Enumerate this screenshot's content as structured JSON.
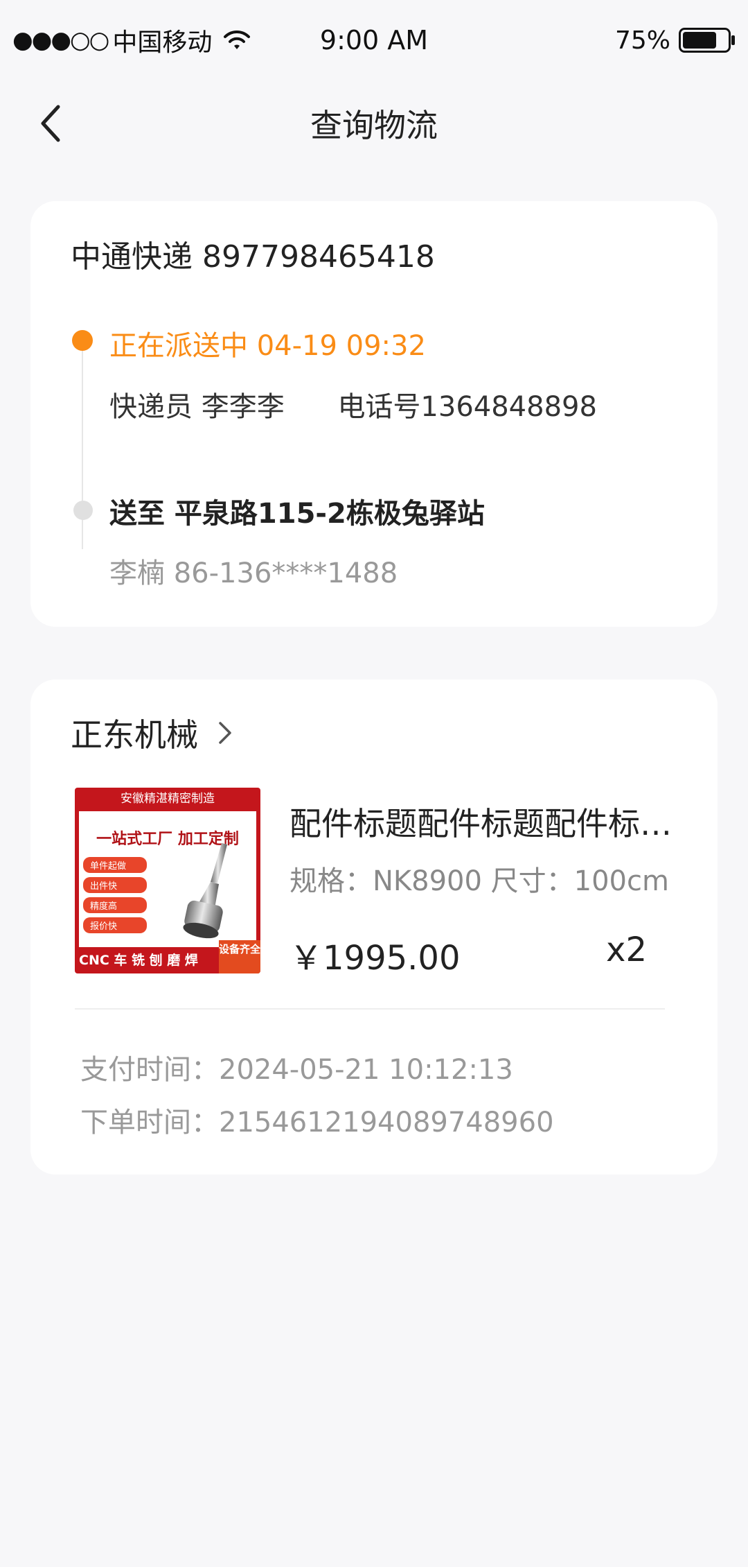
{
  "status_bar": {
    "signal": "●●●○○",
    "carrier": "中国移动",
    "time": "9:00 AM",
    "battery_pct": "75%",
    "battery_level": 0.75
  },
  "nav": {
    "title": "查询物流",
    "back_icon": "chevron-left-icon"
  },
  "logistics": {
    "carrier_tracking": "中通快递 897798465418",
    "current_status": "正在派送中 04-19 09:32",
    "courier": "快递员 李李李",
    "courier_phone": "电话号1364848898",
    "destination": "送至 平泉路115-2栋极兔驿站",
    "receiver": "李楠 86-136****1488",
    "active_color": "#fa8c16"
  },
  "order": {
    "shop_name": "正东机械",
    "product": {
      "image_top": "安徽精湛精密制造",
      "image_headline": "一站式工厂  加工定制",
      "image_tags": [
        "单件起做",
        "出件快",
        "精度高",
        "报价快"
      ],
      "image_bottom": "CNC 车 铣 刨 磨 焊",
      "image_corner": "设备齐全",
      "title": "配件标题配件标题配件标题配件标题",
      "spec": "规格：NK8900 尺寸：100cm",
      "price": "￥1995.00",
      "qty": "x2"
    },
    "pay_time": "支付时间：2024-05-21  10:12:13",
    "order_no": "下单时间：2154612194089748960"
  }
}
